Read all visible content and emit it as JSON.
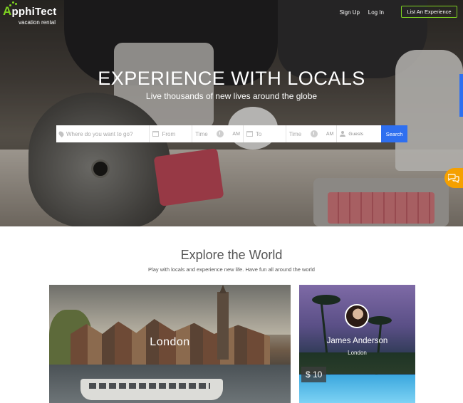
{
  "brand": {
    "name_first": "A",
    "name_rest": "pphiTect",
    "tagline": "vacation rental",
    "accent": "#7ed321"
  },
  "nav": {
    "signup": "Sign Up",
    "login": "Log In",
    "list_experience": "List An Experience"
  },
  "hero": {
    "title": "EXPERIENCE WITH LOCALS",
    "subtitle": "Live thousands of new lives around the globe"
  },
  "search": {
    "where_placeholder": "Where do you want to go?",
    "from_placeholder": "From",
    "from_time": "Time",
    "from_ampm": "AM",
    "to_placeholder": "To",
    "to_time": "Time",
    "to_ampm": "AM",
    "guests": "Guests",
    "button": "Search",
    "button_color": "#2e6ff0"
  },
  "explore": {
    "title": "Explore the World",
    "subtitle": "Play with locals and experience new life. Have fun all around the world"
  },
  "cards": {
    "city": {
      "name": "London"
    },
    "host": {
      "name": "James Anderson",
      "city": "London",
      "price": "$ 10"
    }
  },
  "icons": {
    "chat": "chat-bubbles-icon",
    "location": "location-pin-icon",
    "calendar": "calendar-icon",
    "clock": "clock-icon",
    "guests": "person-icon"
  },
  "colors": {
    "chat_button": "#f5a000"
  }
}
